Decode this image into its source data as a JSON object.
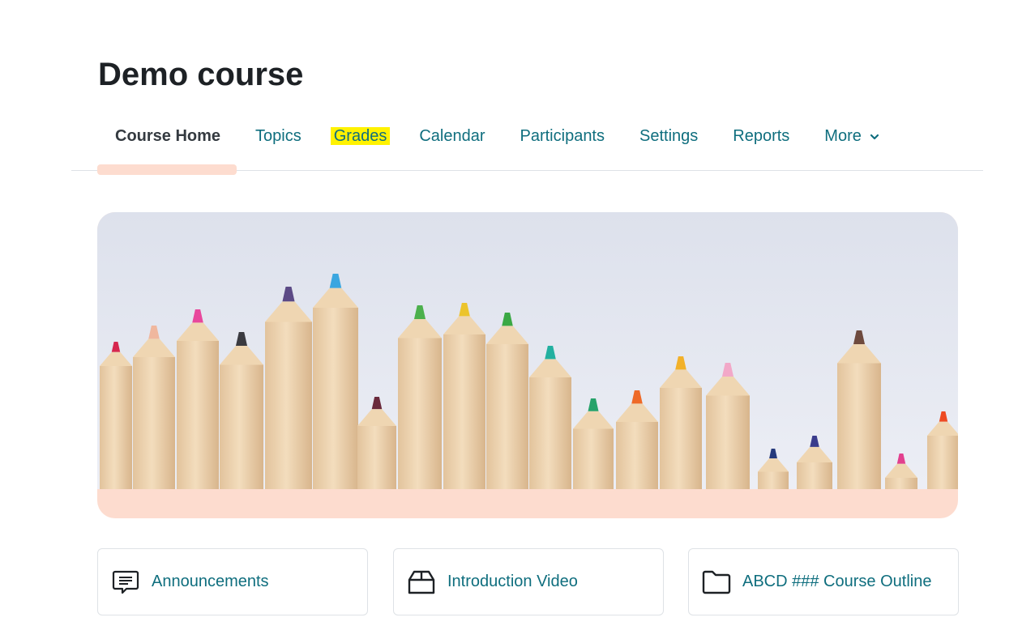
{
  "course": {
    "title": "Demo course"
  },
  "nav": {
    "tabs": [
      {
        "label": "Course Home"
      },
      {
        "label": "Topics"
      },
      {
        "label": "Grades"
      },
      {
        "label": "Calendar"
      },
      {
        "label": "Participants"
      },
      {
        "label": "Settings"
      },
      {
        "label": "Reports"
      },
      {
        "label": "More"
      }
    ],
    "active_index": 0,
    "highlighted_index": 2
  },
  "colors": {
    "link": "#0f6e7e",
    "active_tab": "#343a40",
    "accent": "#fddccf",
    "highlight": "#fff200"
  },
  "hero": {
    "image_alt": "colored-pencils-banner"
  },
  "cards": [
    {
      "label": "Announcements",
      "icon": "forum-icon"
    },
    {
      "label": "Introduction Video",
      "icon": "package-icon"
    },
    {
      "label": "ABCD ### Course Outline",
      "icon": "folder-icon"
    }
  ]
}
